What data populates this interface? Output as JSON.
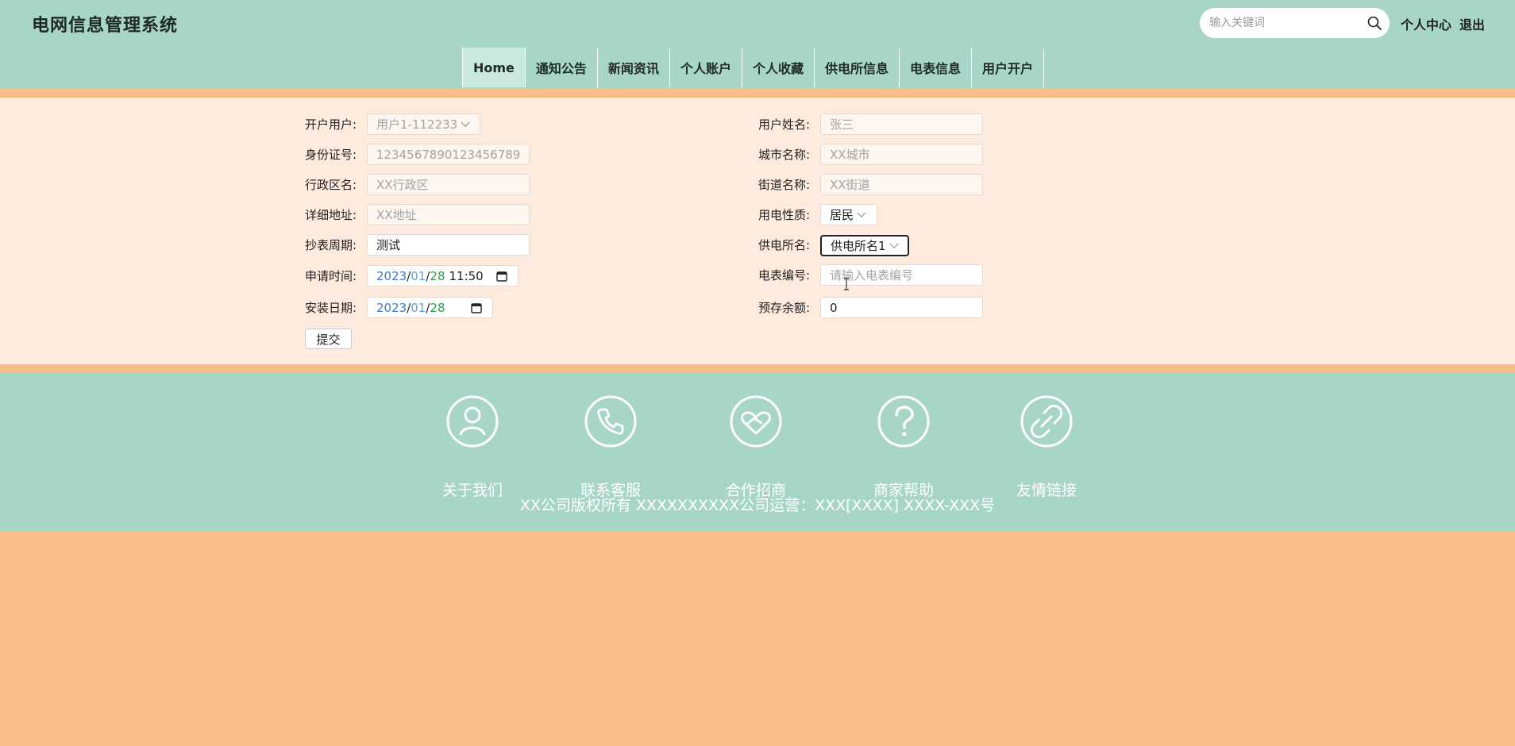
{
  "header": {
    "title": "电网信息管理系统",
    "search_placeholder": "输入关键词",
    "links": {
      "profile": "个人中心",
      "logout": "退出"
    }
  },
  "nav": {
    "items": [
      "Home",
      "通知公告",
      "新闻资讯",
      "个人账户",
      "个人收藏",
      "供电所信息",
      "电表信息",
      "用户开户"
    ],
    "active": "Home"
  },
  "form": {
    "open_user": {
      "label": "开户用户:",
      "value": "用户1-112233"
    },
    "id_number": {
      "label": "身份证号:",
      "value": "1234567890123456789"
    },
    "district": {
      "label": "行政区名:",
      "value": "XX行政区"
    },
    "address": {
      "label": "详细地址:",
      "value": "XX地址"
    },
    "reading_cycle": {
      "label": "抄表周期:",
      "value": "测试"
    },
    "apply_time": {
      "label": "申请时间:",
      "year": "2023",
      "month": "01",
      "day": "28",
      "time": "11:50"
    },
    "install_date": {
      "label": "安装日期:",
      "year": "2023",
      "month": "01",
      "day": "28"
    },
    "user_name": {
      "label": "用户姓名:",
      "value": "张三"
    },
    "city": {
      "label": "城市名称:",
      "value": "XX城市"
    },
    "street": {
      "label": "街道名称:",
      "value": "XX街道"
    },
    "usage_type": {
      "label": "用电性质:",
      "value": "居民"
    },
    "station": {
      "label": "供电所名:",
      "value": "供电所名1"
    },
    "meter_no": {
      "label": "电表编号:",
      "placeholder": "请输入电表编号"
    },
    "prepaid": {
      "label": "预存余额:",
      "value": "0"
    },
    "submit_label": "提交"
  },
  "footer": {
    "items": [
      {
        "label": "关于我们",
        "icon": "user-icon"
      },
      {
        "label": "联系客服",
        "icon": "phone-icon"
      },
      {
        "label": "合作招商",
        "icon": "heart-handshake-icon"
      },
      {
        "label": "商家帮助",
        "icon": "question-icon"
      },
      {
        "label": "友情链接",
        "icon": "link-icon"
      }
    ],
    "copyright": "XX公司版权所有 XXXXXXXXXX公司运营：XXX[XXXX] XXXX-XXX号"
  },
  "colors": {
    "header_bg": "#a8d6c4",
    "page_bg": "#f8be87",
    "content_bg": "#feebdd"
  }
}
